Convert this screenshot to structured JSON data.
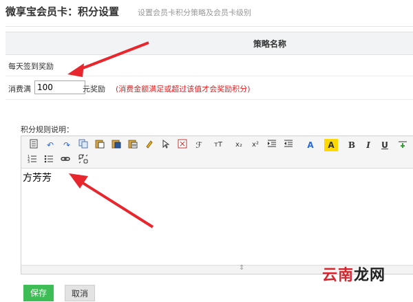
{
  "header": {
    "title": "微享宝会员卡：积分设置",
    "subtitle": "设置会员卡积分策略及会员卡级别"
  },
  "table": {
    "column_header": "策略名称",
    "row_signin": "每天签到奖励",
    "row_consume": {
      "prefix": "消费满",
      "value": "100",
      "suffix": "元奖励",
      "hint": "(消费金额满足或超过该值才会奖励积分)"
    }
  },
  "editor": {
    "label": "积分规则说明：",
    "content": "方芳芳",
    "toolbar_row1": [
      "source-icon",
      "undo-icon",
      "redo-icon",
      "copy-icon",
      "paste-icon",
      "paste-word-icon",
      "paste-text-icon",
      "format-brush-icon",
      "select-icon",
      "fullscreen-icon",
      "font-family-icon",
      "font-size-icon",
      "subscript-icon",
      "superscript-icon",
      "indent-icon",
      "outdent-icon",
      "font-color-icon",
      "highlight-icon",
      "bold-icon",
      "italic-icon",
      "underline-icon",
      "insert-icon"
    ],
    "toolbar_row2": [
      "ordered-list-icon",
      "unordered-list-icon",
      "link-icon",
      "unlink-icon"
    ],
    "tb": {
      "font": "ℱ",
      "tsize": "тT",
      "sub": "x₂",
      "sup": "x²",
      "fcolor": "A",
      "hl": "A",
      "bold": "B",
      "italic": "I",
      "underline": "U"
    }
  },
  "buttons": {
    "save": "保存",
    "cancel": "取消"
  },
  "watermark": {
    "red": "云南",
    "black": "龙网"
  },
  "colors": {
    "accent_green": "#3ebc55",
    "hint_red": "#e02020",
    "arrow_red": "#e8262e"
  }
}
